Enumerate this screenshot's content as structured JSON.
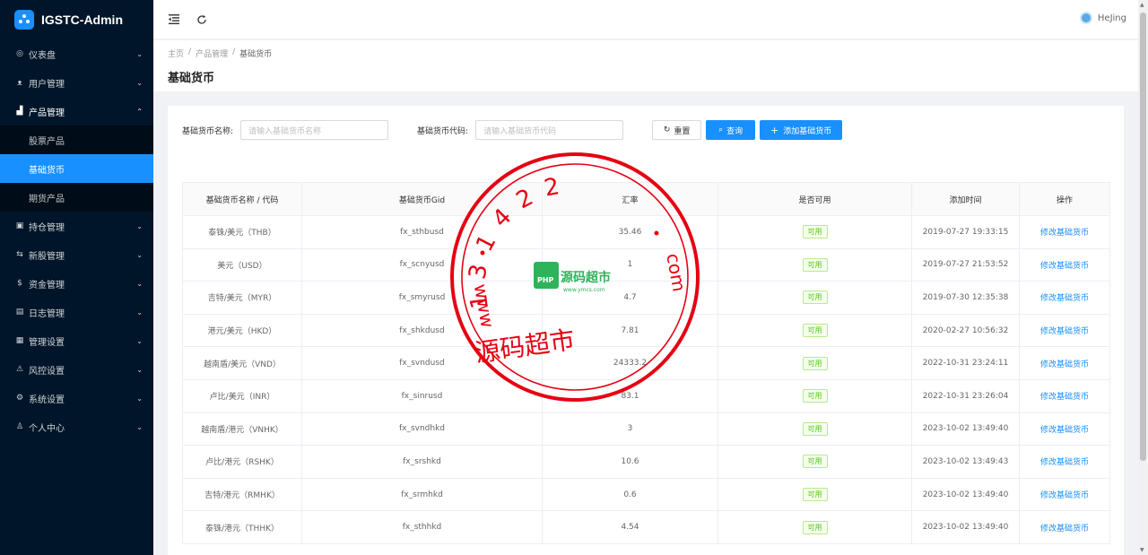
{
  "app": {
    "title": "IGSTC-Admin"
  },
  "user": {
    "name": "HeJing"
  },
  "sidebar": {
    "items": [
      {
        "label": "仪表盘",
        "icon": "dashboard-icon",
        "glyph": "◎"
      },
      {
        "label": "用户管理",
        "icon": "users-icon",
        "glyph": "ᴥ"
      },
      {
        "label": "产品管理",
        "icon": "chart-icon",
        "glyph": "▟",
        "open": true
      },
      {
        "label": "持仓管理",
        "icon": "holdings-icon",
        "glyph": "▣"
      },
      {
        "label": "新股管理",
        "icon": "ipo-icon",
        "glyph": "⇆"
      },
      {
        "label": "资金管理",
        "icon": "money-icon",
        "glyph": "$"
      },
      {
        "label": "日志管理",
        "icon": "log-icon",
        "glyph": "▤"
      },
      {
        "label": "管理设置",
        "icon": "admin-settings-icon",
        "glyph": "▦"
      },
      {
        "label": "风控设置",
        "icon": "risk-warning-icon",
        "glyph": "⚠"
      },
      {
        "label": "系统设置",
        "icon": "settings-gear-icon",
        "glyph": "⚙"
      },
      {
        "label": "个人中心",
        "icon": "person-icon",
        "glyph": "♙"
      }
    ],
    "sub_items": [
      {
        "label": "股票产品",
        "active": false
      },
      {
        "label": "基础货币",
        "active": true
      },
      {
        "label": "期货产品",
        "active": false
      }
    ]
  },
  "breadcrumb": {
    "home": "主页",
    "sep": "/",
    "parent": "产品管理",
    "current": "基础货币"
  },
  "page": {
    "title": "基础货币"
  },
  "filters": {
    "name_label": "基础货币名称:",
    "name_placeholder": "请输入基础货币名称",
    "code_label": "基础货币代码:",
    "code_placeholder": "请输入基础货币代码",
    "reset_label": "重置",
    "search_label": "查询",
    "add_label": "添加基础货币"
  },
  "table": {
    "columns": [
      "基础货币名称 / 代码",
      "基础货币Gid",
      "汇率",
      "是否可用",
      "添加时间",
      "操作"
    ],
    "rows": [
      {
        "name": "泰铢/美元（THB）",
        "gid": "fx_sthbusd",
        "rate": "35.46",
        "status": "可用",
        "time": "2019-07-27 19:33:15",
        "action": "修改基础货币"
      },
      {
        "name": "美元（USD）",
        "gid": "fx_scnyusd",
        "rate": "1",
        "status": "可用",
        "time": "2019-07-27 21:53:52",
        "action": "修改基础货币"
      },
      {
        "name": "吉特/美元（MYR）",
        "gid": "fx_smyrusd",
        "rate": "4.7",
        "status": "可用",
        "time": "2019-07-30 12:35:38",
        "action": "修改基础货币"
      },
      {
        "name": "港元/美元（HKD）",
        "gid": "fx_shkdusd",
        "rate": "7.81",
        "status": "可用",
        "time": "2020-02-27 10:56:32",
        "action": "修改基础货币"
      },
      {
        "name": "越南盾/美元（VND）",
        "gid": "fx_svndusd",
        "rate": "24333.2",
        "status": "可用",
        "time": "2022-10-31 23:24:11",
        "action": "修改基础货币"
      },
      {
        "name": "卢比/美元（INR）",
        "gid": "fx_sinrusd",
        "rate": "83.1",
        "status": "可用",
        "time": "2022-10-31 23:26:04",
        "action": "修改基础货币"
      },
      {
        "name": "越南盾/港元（VNHK）",
        "gid": "fx_svndhkd",
        "rate": "3",
        "status": "可用",
        "time": "2023-10-02 13:49:40",
        "action": "修改基础货币"
      },
      {
        "name": "卢比/港元（RSHK）",
        "gid": "fx_srshkd",
        "rate": "10.6",
        "status": "可用",
        "time": "2023-10-02 13:49:43",
        "action": "修改基础货币"
      },
      {
        "name": "吉特/港元（RMHK）",
        "gid": "fx_srmhkd",
        "rate": "0.6",
        "status": "可用",
        "time": "2023-10-02 13:49:40",
        "action": "修改基础货币"
      },
      {
        "name": "泰铢/港元（THHK）",
        "gid": "fx_sthhkd",
        "rate": "4.54",
        "status": "可用",
        "time": "2023-10-02 13:49:40",
        "action": "修改基础货币"
      }
    ]
  },
  "watermark": {
    "text_top": "131422",
    "text_bottom": "源码超市",
    "domain": "www.  .com",
    "brand": "源码超市",
    "brand_sub": "www.ymcs.com",
    "php": "PHP"
  },
  "colors": {
    "sidebar_bg": "#001529",
    "accent": "#1890ff",
    "stamp_red": "#e60012",
    "tag_green": "#52c41a"
  }
}
